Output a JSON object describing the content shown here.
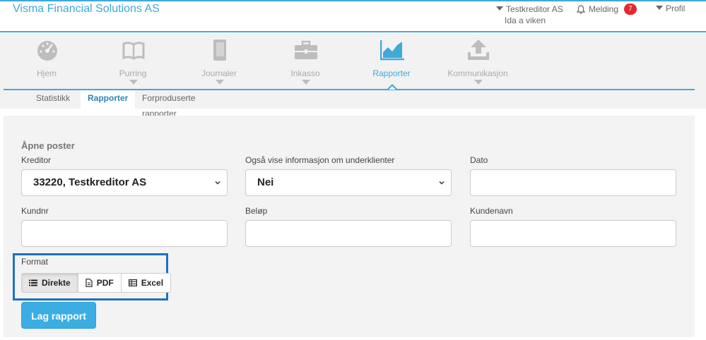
{
  "header": {
    "brand": "Visma Financial Solutions AS",
    "creditor": "Testkreditor AS",
    "user": "Ida a viken",
    "messages_label": "Melding",
    "messages_count": "7",
    "profile_label": "Profil"
  },
  "nav": {
    "items": [
      {
        "label": "Hjem",
        "icon": "dashboard-icon"
      },
      {
        "label": "Purring",
        "icon": "book-icon"
      },
      {
        "label": "Journaler",
        "icon": "journal-icon"
      },
      {
        "label": "Inkasso",
        "icon": "briefcase-icon"
      },
      {
        "label": "Rapporter",
        "icon": "area-chart-icon"
      },
      {
        "label": "Kommunikasjon",
        "icon": "upload-icon"
      }
    ],
    "active": "Rapporter",
    "subtabs": [
      "Statistikk",
      "Rapporter",
      "Forproduserte rapporter"
    ],
    "active_subtab": "Rapporter"
  },
  "form": {
    "section_title": "Åpne poster",
    "kreditor_label": "Kreditor",
    "kreditor_value": "33220, Testkreditor AS",
    "underklienter_label": "Også vise informasjon om underklienter",
    "underklienter_value": "Nei",
    "dato_label": "Dato",
    "dato_value": "",
    "kundenr_label": "Kundnr",
    "kundenr_value": "",
    "belop_label": "Beløp",
    "belop_value": "",
    "kundenavn_label": "Kundenavn",
    "kundenavn_value": "",
    "format_label": "Format",
    "format_options": [
      "Direkte",
      "PDF",
      "Excel"
    ],
    "format_selected": "Direkte",
    "submit_label": "Lag rapport"
  },
  "colors": {
    "accent": "#3fa9d8",
    "highlight_box": "#1f6fc5",
    "badge": "#e8262b",
    "primary_button": "#3aaee3"
  }
}
